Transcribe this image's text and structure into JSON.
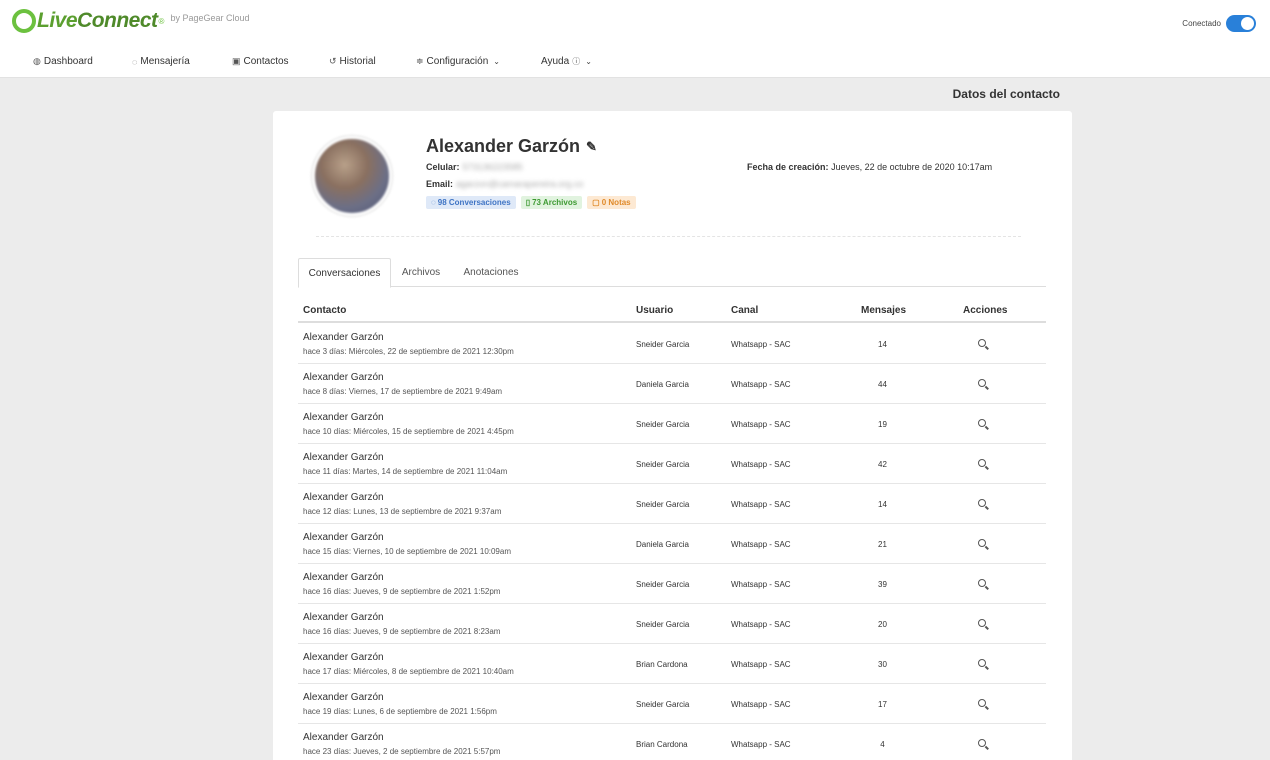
{
  "brand": {
    "name_a": "Live",
    "name_b": "Connect",
    "reg": "®",
    "by": "by PageGear Cloud"
  },
  "status": {
    "label": "Conectado",
    "on": true,
    "accent": "#2980d9"
  },
  "nav": [
    {
      "label": "Dashboard",
      "icon": "dashboard-icon",
      "glyph": "◍"
    },
    {
      "label": "Mensajería",
      "icon": "chat-icon",
      "glyph": "◌"
    },
    {
      "label": "Contactos",
      "icon": "contact-card-icon",
      "glyph": "▣"
    },
    {
      "label": "Historial",
      "icon": "history-icon",
      "glyph": "↺"
    },
    {
      "label": "Configuración",
      "icon": "sliders-icon",
      "glyph": "≑"
    },
    {
      "label": "Ayuda",
      "icon": "help-icon",
      "glyph": ""
    }
  ],
  "page": {
    "title": "Datos del contacto"
  },
  "contact": {
    "name": "Alexander Garzón",
    "edit_glyph": "✎",
    "phone_label": "Celular:",
    "phone_value": "573136223585",
    "email_label": "Email:",
    "email_value": "agarzon@camarapereira.org.co",
    "created_label": "Fecha de creación:",
    "created_value": "Jueves, 22 de octubre de 2020 10:17am",
    "badges": {
      "conversations": "98 Conversaciones",
      "files": "73 Archivos",
      "notes": "0 Notas"
    }
  },
  "tabs": [
    "Conversaciones",
    "Archivos",
    "Anotaciones"
  ],
  "table": {
    "headers": {
      "contact": "Contacto",
      "user": "Usuario",
      "channel": "Canal",
      "messages": "Mensajes",
      "actions": "Acciones"
    },
    "rows": [
      {
        "name": "Alexander Garzón",
        "date": "hace 3 días: Miércoles, 22 de septiembre de 2021 12:30pm",
        "user": "Sneider Garcia",
        "channel": "Whatsapp - SAC",
        "messages": "14"
      },
      {
        "name": "Alexander Garzón",
        "date": "hace 8 días: Viernes, 17 de septiembre de 2021 9:49am",
        "user": "Daniela Garcia",
        "channel": "Whatsapp - SAC",
        "messages": "44"
      },
      {
        "name": "Alexander Garzón",
        "date": "hace 10 días: Miércoles, 15 de septiembre de 2021 4:45pm",
        "user": "Sneider Garcia",
        "channel": "Whatsapp - SAC",
        "messages": "19"
      },
      {
        "name": "Alexander Garzón",
        "date": "hace 11 días: Martes, 14 de septiembre de 2021 11:04am",
        "user": "Sneider Garcia",
        "channel": "Whatsapp - SAC",
        "messages": "42"
      },
      {
        "name": "Alexander Garzón",
        "date": "hace 12 días: Lunes, 13 de septiembre de 2021 9:37am",
        "user": "Sneider Garcia",
        "channel": "Whatsapp - SAC",
        "messages": "14"
      },
      {
        "name": "Alexander Garzón",
        "date": "hace 15 días: Viernes, 10 de septiembre de 2021 10:09am",
        "user": "Daniela Garcia",
        "channel": "Whatsapp - SAC",
        "messages": "21"
      },
      {
        "name": "Alexander Garzón",
        "date": "hace 16 días: Jueves, 9 de septiembre de 2021 1:52pm",
        "user": "Sneider Garcia",
        "channel": "Whatsapp - SAC",
        "messages": "39"
      },
      {
        "name": "Alexander Garzón",
        "date": "hace 16 días: Jueves, 9 de septiembre de 2021 8:23am",
        "user": "Sneider Garcia",
        "channel": "Whatsapp - SAC",
        "messages": "20"
      },
      {
        "name": "Alexander Garzón",
        "date": "hace 17 días: Miércoles, 8 de septiembre de 2021 10:40am",
        "user": "Brian Cardona",
        "channel": "Whatsapp - SAC",
        "messages": "30"
      },
      {
        "name": "Alexander Garzón",
        "date": "hace 19 días: Lunes, 6 de septiembre de 2021 1:56pm",
        "user": "Sneider Garcia",
        "channel": "Whatsapp - SAC",
        "messages": "17"
      },
      {
        "name": "Alexander Garzón",
        "date": "hace 23 días: Jueves, 2 de septiembre de 2021 5:57pm",
        "user": "Brian Cardona",
        "channel": "Whatsapp - SAC",
        "messages": "4"
      }
    ]
  }
}
